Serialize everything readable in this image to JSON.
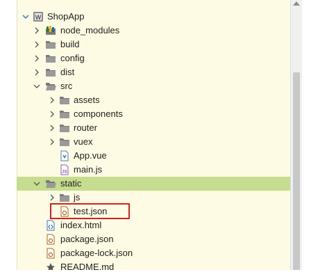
{
  "tree": {
    "root": {
      "label": "ShopApp",
      "badge": "W"
    },
    "items": [
      {
        "label": "node_modules"
      },
      {
        "label": "build"
      },
      {
        "label": "config"
      },
      {
        "label": "dist"
      },
      {
        "label": "src"
      },
      {
        "label": "assets"
      },
      {
        "label": "components"
      },
      {
        "label": "router"
      },
      {
        "label": "vuex"
      },
      {
        "label": "App.vue"
      },
      {
        "label": "main.js",
        "badge": "JS"
      },
      {
        "label": "static"
      },
      {
        "label": "js"
      },
      {
        "label": "test.json"
      },
      {
        "label": "index.html"
      },
      {
        "label": "package.json"
      },
      {
        "label": "package-lock.json"
      },
      {
        "label": "README.md"
      }
    ]
  },
  "colors": {
    "panel_bg": "#fdfbe3",
    "selected_row": "#c6dc8e",
    "highlight_border": "#d42020",
    "chevron": "#5a5a5a",
    "folder": "#7a7a7a"
  }
}
